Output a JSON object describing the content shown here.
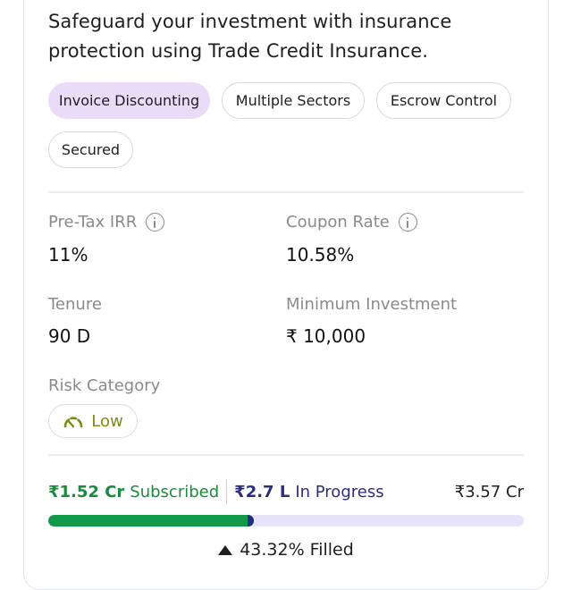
{
  "description": "Safeguard your investment with insurance protection using Trade Credit Insurance.",
  "tags": [
    {
      "label": "Invoice Discounting",
      "active": true
    },
    {
      "label": "Multiple Sectors",
      "active": false
    },
    {
      "label": "Escrow Control",
      "active": false
    },
    {
      "label": "Secured",
      "active": false
    }
  ],
  "metrics": {
    "pre_tax_irr": {
      "label": "Pre-Tax IRR",
      "value": "11%"
    },
    "coupon_rate": {
      "label": "Coupon Rate",
      "value": "10.58%"
    },
    "tenure": {
      "label": "Tenure",
      "value": "90 D"
    },
    "min_investment": {
      "label": "Minimum Investment",
      "value": "₹ 10,000"
    }
  },
  "risk": {
    "label": "Risk Category",
    "value": "Low",
    "color": "#7d8a16"
  },
  "subscription": {
    "subscribed_amount": "₹1.52 Cr",
    "subscribed_label": "Subscribed",
    "in_progress_amount": "₹2.7 L",
    "in_progress_label": "In Progress",
    "total": "₹3.57 Cr",
    "filled_percent": 43.32,
    "filled_text": "43.32% Filled"
  },
  "colors": {
    "accent_tag": "#eadcf8",
    "subscribed": "#1a8a3c",
    "in_progress": "#2b2e7e",
    "bar_track": "#e6e3fa"
  }
}
